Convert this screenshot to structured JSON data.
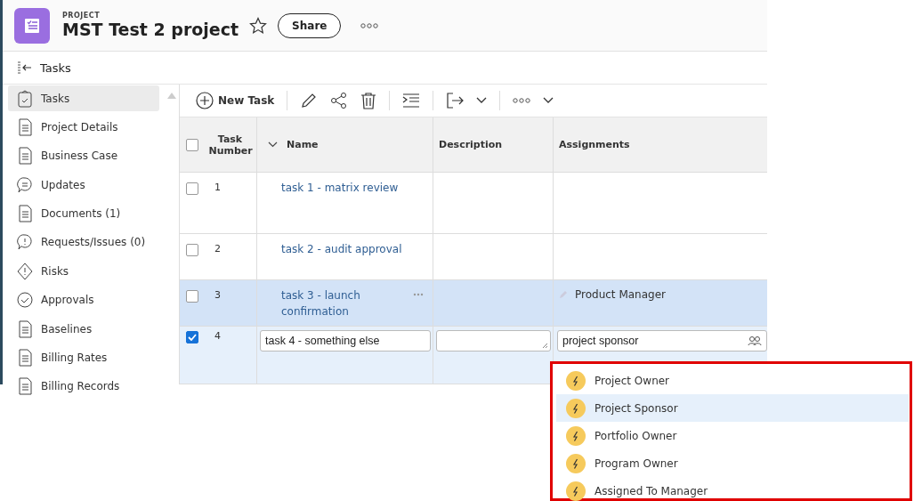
{
  "project": {
    "label": "PROJECT",
    "title": "MST Test 2 project",
    "favorite": false,
    "share_button": "Share"
  },
  "breadcrumb": "Tasks",
  "sidebar": {
    "items": [
      {
        "label": "Tasks",
        "selected": true
      },
      {
        "label": "Project Details",
        "selected": false
      },
      {
        "label": "Business Case",
        "selected": false
      },
      {
        "label": "Updates",
        "selected": false
      },
      {
        "label": "Documents (1)",
        "selected": false
      },
      {
        "label": "Requests/Issues (0)",
        "selected": false
      },
      {
        "label": "Risks",
        "selected": false
      },
      {
        "label": "Approvals",
        "selected": false
      },
      {
        "label": "Baselines",
        "selected": false
      },
      {
        "label": "Billing Rates",
        "selected": false
      },
      {
        "label": "Billing Records",
        "selected": false
      }
    ]
  },
  "toolbar": {
    "new_task": "New Task"
  },
  "table": {
    "header_checked": false,
    "columns": [
      "Task Number",
      "Name",
      "Description",
      "Assignments"
    ],
    "rows": [
      {
        "kind": "view",
        "number": "1",
        "name": "task 1 - matrix review",
        "checked": false,
        "selected": false
      },
      {
        "kind": "view",
        "number": "2",
        "name": "task 2 - audit approval",
        "checked": false,
        "selected": false
      },
      {
        "kind": "view",
        "number": "3",
        "name": "task 3 - launch confirmation",
        "assignment": "Product Manager",
        "checked": false,
        "selected": true
      },
      {
        "kind": "edit",
        "number": "4",
        "name": "task 4 - something else",
        "assignment": "project sponsor",
        "checked": true,
        "selected": false
      }
    ]
  },
  "dropdown": {
    "options": [
      {
        "label": "Project Owner",
        "selected": false
      },
      {
        "label": "Project Sponsor",
        "selected": true
      },
      {
        "label": "Portfolio Owner",
        "selected": false
      },
      {
        "label": "Program Owner",
        "selected": false
      },
      {
        "label": "Assigned To Manager",
        "selected": false
      }
    ]
  }
}
